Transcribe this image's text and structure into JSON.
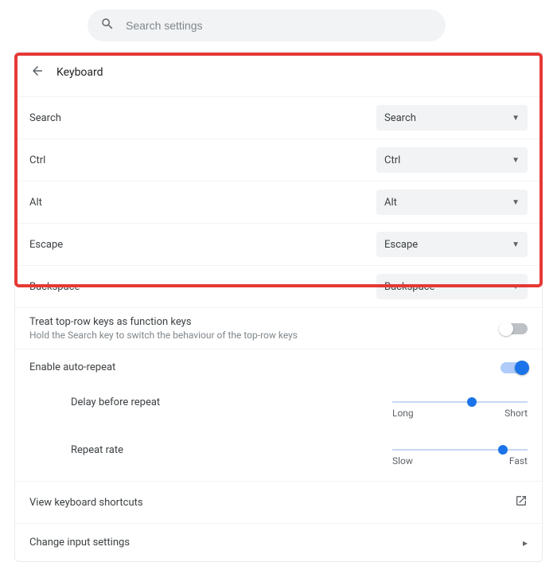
{
  "search": {
    "placeholder": "Search settings"
  },
  "header": {
    "title": "Keyboard"
  },
  "remap": {
    "rows": [
      {
        "label": "Search",
        "value": "Search"
      },
      {
        "label": "Ctrl",
        "value": "Ctrl"
      },
      {
        "label": "Alt",
        "value": "Alt"
      },
      {
        "label": "Escape",
        "value": "Escape"
      },
      {
        "label": "Backspace",
        "value": "Backspace"
      }
    ]
  },
  "toprow": {
    "primary": "Treat top-row keys as function keys",
    "secondary": "Hold the Search key to switch the behaviour of the top-row keys",
    "enabled": false
  },
  "autorepeat": {
    "label": "Enable auto-repeat",
    "enabled": true
  },
  "delay": {
    "label": "Delay before repeat",
    "left": "Long",
    "right": "Short",
    "position": 0.55
  },
  "rate": {
    "label": "Repeat rate",
    "left": "Slow",
    "right": "Fast",
    "position": 0.78
  },
  "shortcuts": {
    "label": "View keyboard shortcuts"
  },
  "change_input": {
    "label": "Change input settings"
  }
}
